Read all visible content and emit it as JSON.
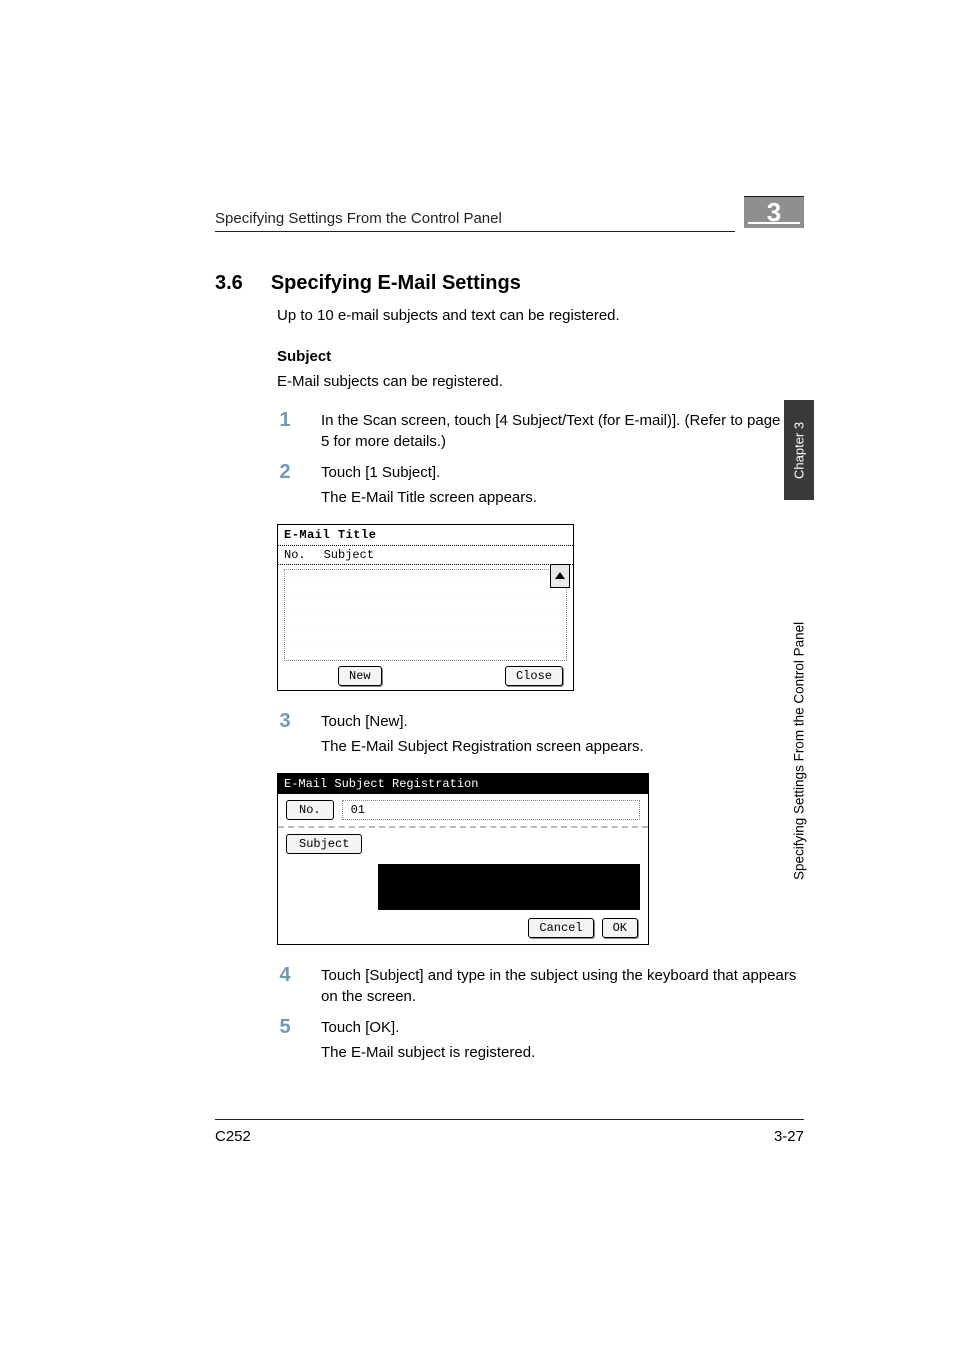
{
  "running_head": "Specifying Settings From the Control Panel",
  "chapter_marker": "3",
  "side_tab_dark": "Chapter 3",
  "side_tab_text": "Specifying Settings From the Control Panel",
  "section": {
    "number": "3.6",
    "title": "Specifying E-Mail Settings",
    "intro": "Up to 10 e-mail subjects and text can be registered.",
    "subhead": "Subject",
    "desc": "E-Mail subjects can be registered."
  },
  "steps": [
    {
      "n": "1",
      "text": "In the Scan screen, touch [4 Subject/Text (for E-mail)]. (Refer to page 3-5 for more details.)"
    },
    {
      "n": "2",
      "text": "Touch [1 Subject].",
      "sub": "The E-Mail Title screen appears."
    },
    {
      "n": "3",
      "text": "Touch [New].",
      "sub": "The E-Mail Subject Registration screen appears."
    },
    {
      "n": "4",
      "text": "Touch [Subject] and type in the subject using the keyboard that appears on the screen."
    },
    {
      "n": "5",
      "text": "Touch [OK].",
      "sub": "The E-Mail subject is registered."
    }
  ],
  "mfp1": {
    "title": "E-Mail Title",
    "col_no": "No.",
    "col_subject": "Subject",
    "btn_new": "New",
    "btn_close": "Close"
  },
  "mfp2": {
    "title": "E-Mail Subject Registration",
    "lbl_no": "No.",
    "val_no": "01",
    "lbl_subject": "Subject",
    "btn_cancel": "Cancel",
    "btn_ok": "OK"
  },
  "footer": {
    "left": "C252",
    "right": "3-27"
  }
}
